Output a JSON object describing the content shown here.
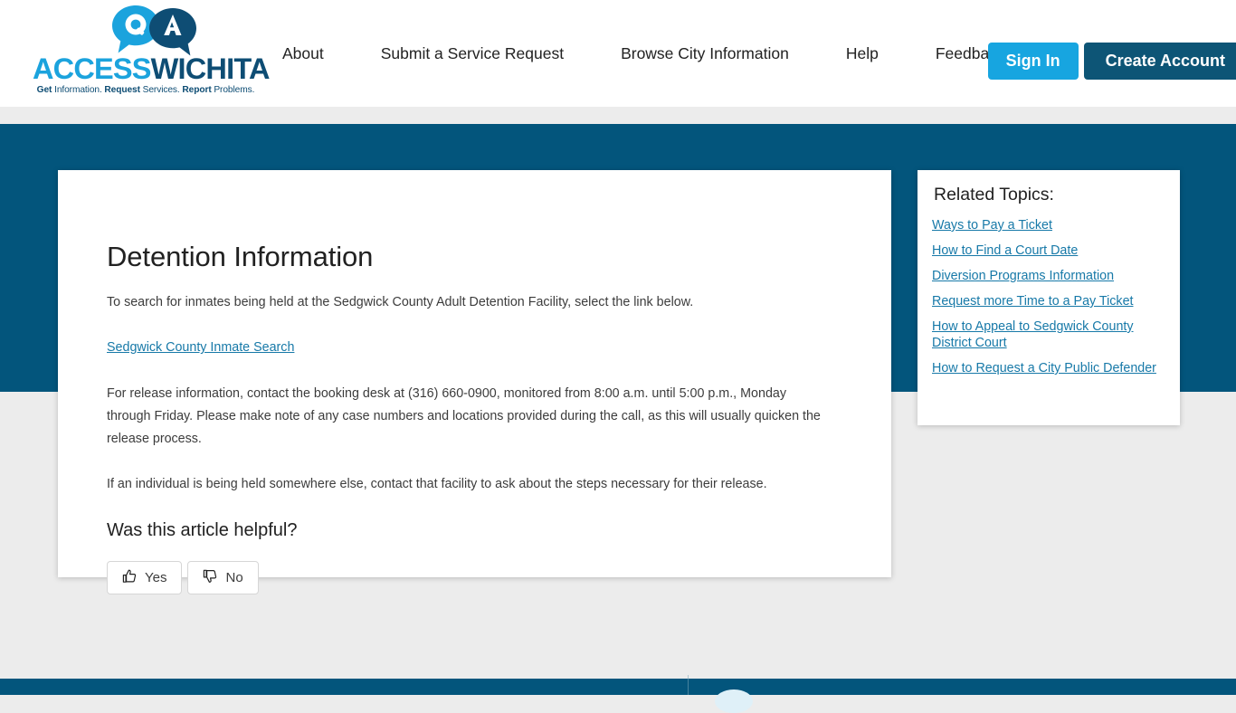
{
  "header": {
    "logo": {
      "bubble_q": "Q",
      "bubble_a": "A",
      "word_access": "ACCESS",
      "word_wichita": "WICHITA",
      "tagline_get": "Get",
      "tagline_information": " Information. ",
      "tagline_request": "Request",
      "tagline_services": " Services. ",
      "tagline_report": "Report",
      "tagline_problems": " Problems.",
      "accent_light": "#1ba3dd",
      "accent_dark": "#0e4d74"
    },
    "nav": [
      {
        "label": "About",
        "icon": ""
      },
      {
        "label": "Submit a Service Request",
        "icon": ""
      },
      {
        "label": "Browse City Information",
        "icon": ""
      },
      {
        "label": "Help",
        "icon": ""
      },
      {
        "label": "Feedback",
        "icon": "speech-bubble-icon"
      }
    ],
    "sign_in_label": "Sign In",
    "create_account_label": "Create Account",
    "sign_in_color": "#17a5e0",
    "create_account_color": "#0d5576"
  },
  "banner": {
    "color": "#03557c"
  },
  "article": {
    "title": "Detention Information",
    "lede": "To search for inmates being held at the Sedgwick County Adult Detention Facility, select the link below.",
    "inmate_search_link": "Sedgwick County Inmate Search",
    "paragraph_1": "For release information, contact the booking desk at (316) 660-0900, monitored from 8:00 a.m. until 5:00 p.m., Monday through Friday.  Please make note of any case numbers and locations provided during the call, as this will usually quicken the release process.",
    "paragraph_2": "If an individual is being held somewhere else, contact that facility to ask about the steps necessary for their release.",
    "helpful_heading": "Was this article helpful?",
    "vote_yes_label": "Yes",
    "vote_no_label": "No",
    "link_color": "#1779a8"
  },
  "related": {
    "title": "Related Topics:",
    "topics": [
      {
        "label": "Ways to Pay a Ticket"
      },
      {
        "label": "How to Find a Court Date"
      },
      {
        "label": "Diversion Programs Information"
      },
      {
        "label": "Request more Time to a Pay Ticket"
      },
      {
        "label": "How to Appeal to Sedgwick County District Court"
      },
      {
        "label": "How to Request a City Public Defender"
      }
    ]
  },
  "footer": {
    "color": "#03557c"
  }
}
